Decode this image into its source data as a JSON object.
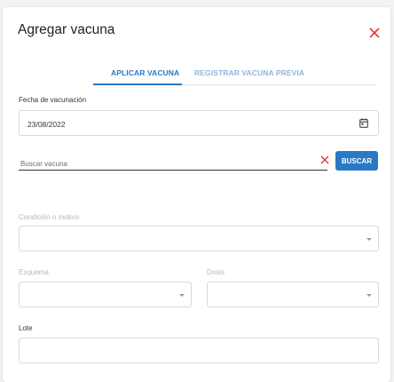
{
  "dialog": {
    "title": "Agregar vacuna",
    "close_icon": "close-icon"
  },
  "tabs": [
    {
      "label": "APLICAR VACUNA",
      "active": true
    },
    {
      "label": "REGISTRAR VACUNA PREVIA",
      "active": false
    }
  ],
  "form": {
    "fecha": {
      "label": "Fecha de vacunación",
      "value": "23/08/2022",
      "icon": "calendar-icon"
    },
    "buscar": {
      "placeholder": "Buscar vacuna",
      "clear_icon": "clear-icon",
      "button_label": "BUSCAR"
    },
    "condicion": {
      "label": "Condición o motivo",
      "value": ""
    },
    "esquema": {
      "label": "Esquema",
      "value": ""
    },
    "dosis": {
      "label": "Dosis",
      "value": ""
    },
    "lote": {
      "label": "Lote",
      "value": ""
    }
  },
  "colors": {
    "accent": "#2a79c5",
    "tab_inactive": "#8eb6de",
    "close_red": "#e53935"
  }
}
